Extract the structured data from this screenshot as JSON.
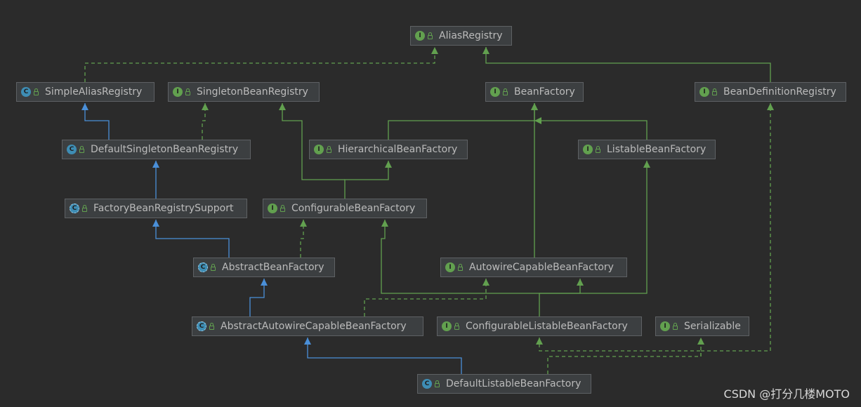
{
  "colors": {
    "background": "#2b2b2b",
    "node_fill": "#3c3f41",
    "node_border": "#5e6164",
    "text": "#bbbbbb",
    "interface_badge": "#62a04f",
    "class_badge": "#3e8db4",
    "extends_interface_edge": "#62a04f",
    "implements_edge": "#62a04f",
    "extends_class_edge": "#4a8fd8"
  },
  "nodes": [
    {
      "id": "AliasRegistry",
      "label": "AliasRegistry",
      "kind": "interface",
      "badge": "I"
    },
    {
      "id": "SimpleAliasRegistry",
      "label": "SimpleAliasRegistry",
      "kind": "class",
      "badge": "C"
    },
    {
      "id": "SingletonBeanRegistry",
      "label": "SingletonBeanRegistry",
      "kind": "interface",
      "badge": "I"
    },
    {
      "id": "BeanFactory",
      "label": "BeanFactory",
      "kind": "interface",
      "badge": "I"
    },
    {
      "id": "BeanDefinitionRegistry",
      "label": "BeanDefinitionRegistry",
      "kind": "interface",
      "badge": "I"
    },
    {
      "id": "DefaultSingletonBeanRegistry",
      "label": "DefaultSingletonBeanRegistry",
      "kind": "class",
      "badge": "C"
    },
    {
      "id": "HierarchicalBeanFactory",
      "label": "HierarchicalBeanFactory",
      "kind": "interface",
      "badge": "I"
    },
    {
      "id": "ListableBeanFactory",
      "label": "ListableBeanFactory",
      "kind": "interface",
      "badge": "I"
    },
    {
      "id": "FactoryBeanRegistrySupport",
      "label": "FactoryBeanRegistrySupport",
      "kind": "abstract",
      "badge": "C"
    },
    {
      "id": "ConfigurableBeanFactory",
      "label": "ConfigurableBeanFactory",
      "kind": "interface",
      "badge": "I"
    },
    {
      "id": "AbstractBeanFactory",
      "label": "AbstractBeanFactory",
      "kind": "abstract",
      "badge": "C"
    },
    {
      "id": "AutowireCapableBeanFactory",
      "label": "AutowireCapableBeanFactory",
      "kind": "interface",
      "badge": "I"
    },
    {
      "id": "AbstractAutowireCapableBeanFactory",
      "label": "AbstractAutowireCapableBeanFactory",
      "kind": "abstract",
      "badge": "C"
    },
    {
      "id": "ConfigurableListableBeanFactory",
      "label": "ConfigurableListableBeanFactory",
      "kind": "interface",
      "badge": "I"
    },
    {
      "id": "Serializable",
      "label": "Serializable",
      "kind": "interface",
      "badge": "I"
    },
    {
      "id": "DefaultListableBeanFactory",
      "label": "DefaultListableBeanFactory",
      "kind": "class",
      "badge": "C"
    }
  ],
  "edges": [
    {
      "from": "SimpleAliasRegistry",
      "to": "AliasRegistry",
      "type": "implements"
    },
    {
      "from": "BeanDefinitionRegistry",
      "to": "AliasRegistry",
      "type": "extends-interface"
    },
    {
      "from": "DefaultSingletonBeanRegistry",
      "to": "SimpleAliasRegistry",
      "type": "extends-class"
    },
    {
      "from": "DefaultSingletonBeanRegistry",
      "to": "SingletonBeanRegistry",
      "type": "implements"
    },
    {
      "from": "FactoryBeanRegistrySupport",
      "to": "DefaultSingletonBeanRegistry",
      "type": "extends-class"
    },
    {
      "from": "HierarchicalBeanFactory",
      "to": "BeanFactory",
      "type": "extends-interface"
    },
    {
      "from": "ListableBeanFactory",
      "to": "BeanFactory",
      "type": "extends-interface"
    },
    {
      "from": "AutowireCapableBeanFactory",
      "to": "BeanFactory",
      "type": "extends-interface"
    },
    {
      "from": "ConfigurableBeanFactory",
      "to": "HierarchicalBeanFactory",
      "type": "extends-interface"
    },
    {
      "from": "ConfigurableBeanFactory",
      "to": "SingletonBeanRegistry",
      "type": "extends-interface"
    },
    {
      "from": "AbstractBeanFactory",
      "to": "FactoryBeanRegistrySupport",
      "type": "extends-class"
    },
    {
      "from": "AbstractBeanFactory",
      "to": "ConfigurableBeanFactory",
      "type": "implements"
    },
    {
      "from": "AbstractAutowireCapableBeanFactory",
      "to": "AbstractBeanFactory",
      "type": "extends-class"
    },
    {
      "from": "AbstractAutowireCapableBeanFactory",
      "to": "AutowireCapableBeanFactory",
      "type": "implements"
    },
    {
      "from": "ConfigurableListableBeanFactory",
      "to": "AutowireCapableBeanFactory",
      "type": "extends-interface"
    },
    {
      "from": "ConfigurableListableBeanFactory",
      "to": "ConfigurableBeanFactory",
      "type": "extends-interface"
    },
    {
      "from": "ConfigurableListableBeanFactory",
      "to": "ListableBeanFactory",
      "type": "extends-interface"
    },
    {
      "from": "DefaultListableBeanFactory",
      "to": "AbstractAutowireCapableBeanFactory",
      "type": "extends-class"
    },
    {
      "from": "DefaultListableBeanFactory",
      "to": "ConfigurableListableBeanFactory",
      "type": "implements"
    },
    {
      "from": "DefaultListableBeanFactory",
      "to": "Serializable",
      "type": "implements"
    },
    {
      "from": "DefaultListableBeanFactory",
      "to": "BeanDefinitionRegistry",
      "type": "implements"
    }
  ],
  "watermark": "CSDN @打分几楼MOTO"
}
